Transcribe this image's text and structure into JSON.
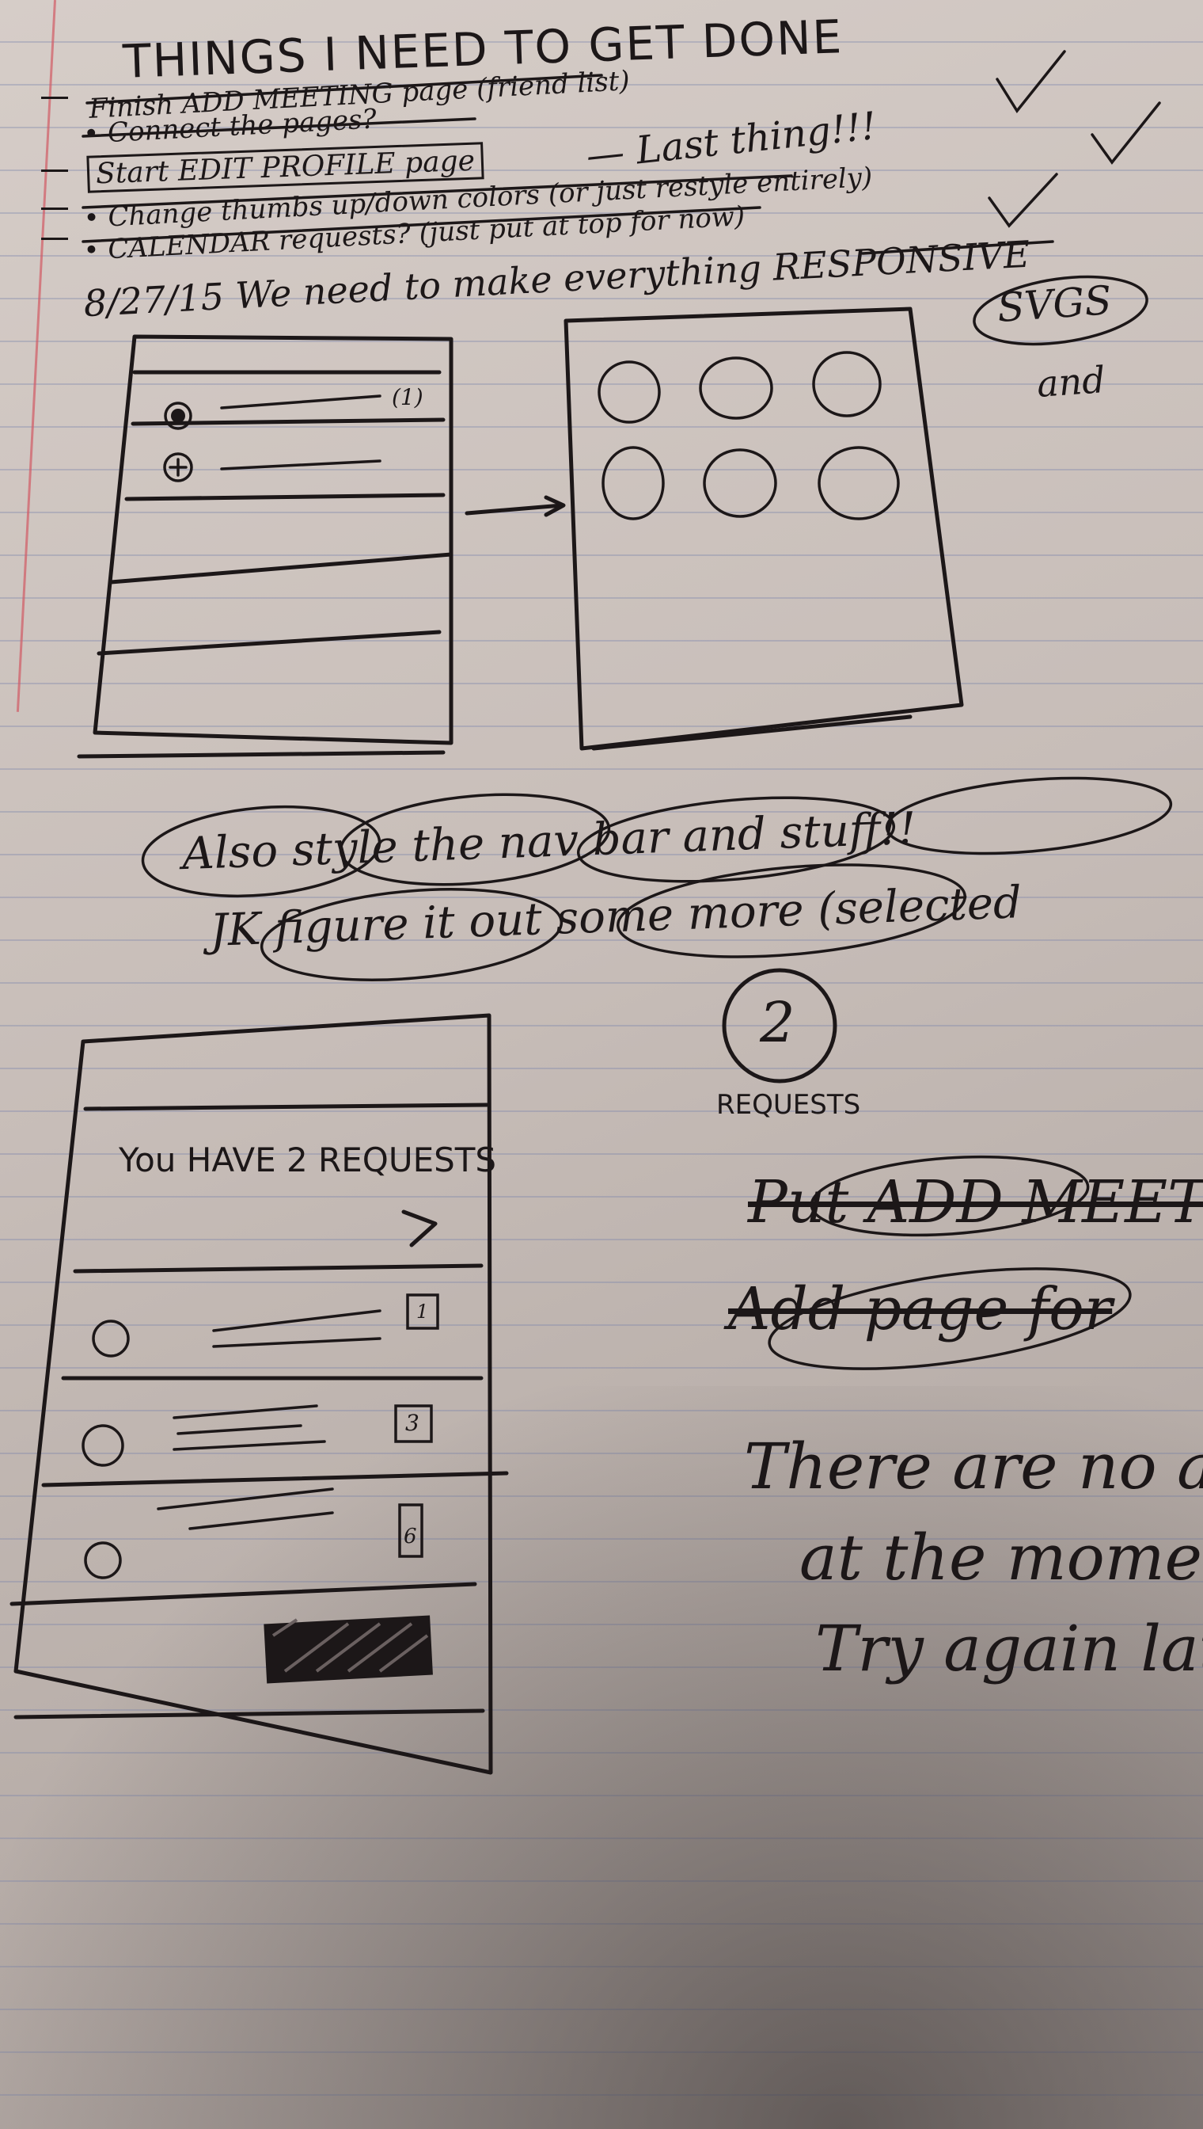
{
  "note": {
    "heading": "THINGS I NEED TO GET DONE",
    "todos": [
      {
        "text": "Finish ADD MEETING page (friend list)"
      },
      {
        "text": "• Connect the pages?"
      },
      {
        "text": "Start EDIT PROFILE page"
      },
      {
        "text": "— Last thing!!!"
      },
      {
        "text": "• Change thumbs up/down colors (or just restyle entirely)"
      },
      {
        "text": "• CALENDAR requests? (just put at top for now)"
      },
      {
        "text": "8/27/15 We need to make everything RESPONSIVE"
      }
    ],
    "side_note": [
      "SVGS",
      "and"
    ],
    "middle_note": [
      "Also style the nav bar and stuff!!",
      "JK figure it out some more (selected"
    ],
    "sketch_list_badge": "(1)",
    "requests_screen": {
      "title": "You HAVE 2 REQUESTS",
      "chevron": ">",
      "badges": [
        "1",
        "3",
        "6"
      ]
    },
    "request_count": "2",
    "request_label": "REQUESTS",
    "right_notes": {
      "line1": "Put ADD MEETI",
      "line2": "Add page for",
      "message": [
        "There are no a",
        "at the mome",
        "Try again lat"
      ]
    }
  }
}
